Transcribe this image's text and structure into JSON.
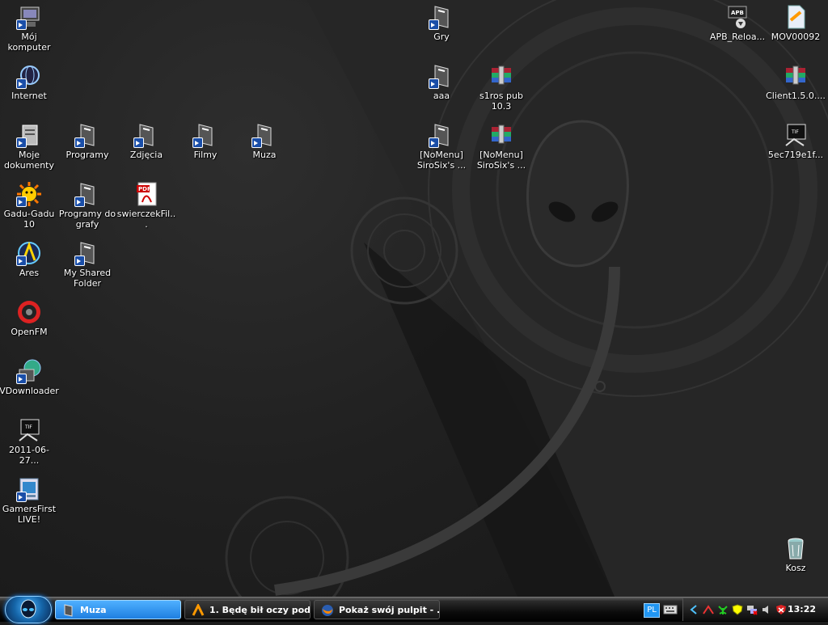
{
  "desktop": {
    "icons": [
      {
        "id": "moj-komputer",
        "label": "Mój komputer"
      },
      {
        "id": "internet",
        "label": "Internet"
      },
      {
        "id": "moje-dokumenty",
        "label": "Moje dokumenty"
      },
      {
        "id": "programy",
        "label": "Programy"
      },
      {
        "id": "zdjecia",
        "label": "Zdjęcia"
      },
      {
        "id": "filmy",
        "label": "Filmy"
      },
      {
        "id": "muza",
        "label": "Muza"
      },
      {
        "id": "gadu-gadu",
        "label": "Gadu-Gadu 10"
      },
      {
        "id": "programy-do-grafy",
        "label": "Programy do grafy"
      },
      {
        "id": "swierczek",
        "label": "swierczekFil..."
      },
      {
        "id": "ares",
        "label": "Ares"
      },
      {
        "id": "my-shared-folder",
        "label": "My Shared Folder"
      },
      {
        "id": "openfm",
        "label": "OpenFM"
      },
      {
        "id": "vdownloader",
        "label": "VDownloader"
      },
      {
        "id": "tif-2011",
        "label": "2011-06-27..."
      },
      {
        "id": "gamersfirst",
        "label": "GamersFirst LIVE!"
      },
      {
        "id": "gry",
        "label": "Gry"
      },
      {
        "id": "aaa",
        "label": "aaa"
      },
      {
        "id": "s1ros",
        "label": "s1ros pub 10.3"
      },
      {
        "id": "nomenu1",
        "label": "[NoMenu] SiroSix's ..."
      },
      {
        "id": "nomenu2",
        "label": "[NoMenu] SiroSix's ..."
      },
      {
        "id": "apb",
        "label": "APB_Reloa..."
      },
      {
        "id": "mov",
        "label": "MOV00092"
      },
      {
        "id": "client",
        "label": "Client1.5.0...."
      },
      {
        "id": "tif-5ec",
        "label": "5ec719e1f..."
      },
      {
        "id": "kosz",
        "label": "Kosz"
      }
    ]
  },
  "icon_glyphs": {
    "apb_text": "APB",
    "tif_text": "TIF",
    "pdf_text": "PDF"
  },
  "taskbar": {
    "tasks": [
      {
        "label": "Muza",
        "state": "active"
      },
      {
        "label": "1. Będę bił oczy pod...",
        "state": "inactive"
      },
      {
        "label": "Pokaż swój pulpit - ...",
        "state": "inactive"
      }
    ],
    "language": "PL",
    "clock": "13:22"
  },
  "colors": {
    "accent": "#2196f3",
    "active_task": "#1f7fe0"
  }
}
